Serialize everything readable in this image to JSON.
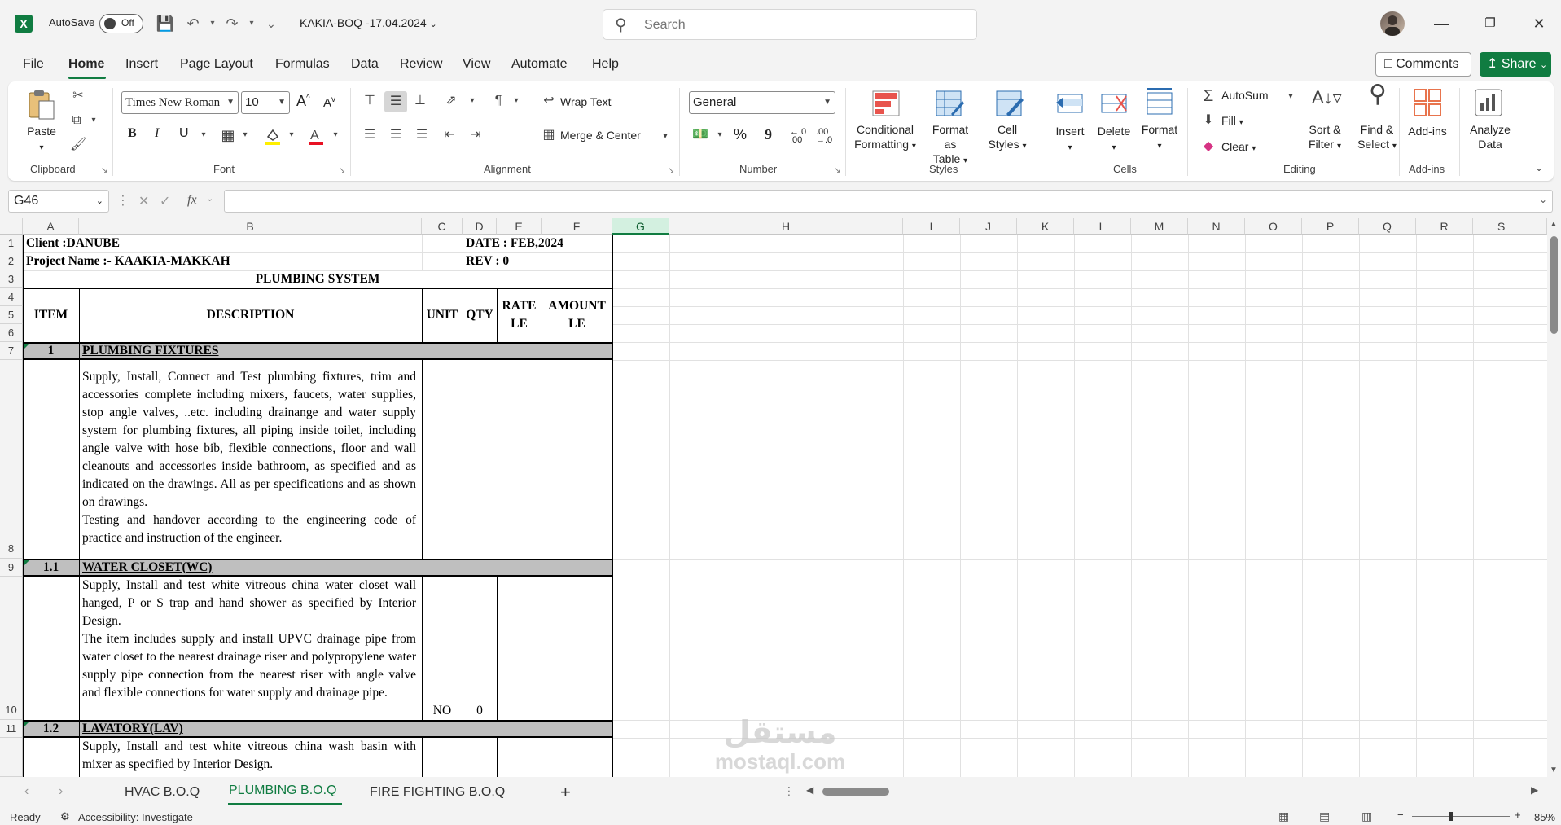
{
  "titlebar": {
    "app_logo": "X",
    "autosave_label": "AutoSave",
    "autosave_state": "Off",
    "document_title": "KAKIA-BOQ -17.04.2024",
    "search_placeholder": "Search",
    "minimize": "—",
    "restore": "❐",
    "close": "✕"
  },
  "menu": {
    "tabs": [
      "File",
      "Home",
      "Insert",
      "Page Layout",
      "Formulas",
      "Data",
      "Review",
      "View",
      "Automate",
      "Help"
    ],
    "comments_label": "Comments",
    "share_label": "Share"
  },
  "ribbon": {
    "clipboard": {
      "paste": "Paste",
      "group": "Clipboard"
    },
    "font": {
      "name": "Times New Roman",
      "size": "10",
      "bold": "B",
      "italic": "I",
      "underline": "U",
      "group": "Font"
    },
    "alignment": {
      "wrap_text": "Wrap Text",
      "merge_center": "Merge & Center",
      "group": "Alignment"
    },
    "number": {
      "format": "General",
      "percent": "%",
      "comma": "9",
      "inc_decimal": "←.0 .00",
      "dec_decimal": ".00 →.0",
      "group": "Number"
    },
    "styles": {
      "conditional_1": "Conditional",
      "conditional_2": "Formatting",
      "format_table_1": "Format as",
      "format_table_2": "Table",
      "cell_styles_1": "Cell",
      "cell_styles_2": "Styles",
      "group": "Styles"
    },
    "cells": {
      "insert": "Insert",
      "delete": "Delete",
      "format": "Format",
      "group": "Cells"
    },
    "editing": {
      "autosum": "AutoSum",
      "fill": "Fill",
      "clear": "Clear",
      "sort_1": "Sort &",
      "sort_2": "Filter",
      "find_1": "Find &",
      "find_2": "Select",
      "group": "Editing"
    },
    "addins": {
      "addins": "Add-ins",
      "group": "Add-ins",
      "analyze_1": "Analyze",
      "analyze_2": "Data"
    }
  },
  "formula_bar": {
    "name_box": "G46",
    "fx": "fx",
    "formula_value": ""
  },
  "grid": {
    "columns": [
      "A",
      "B",
      "C",
      "D",
      "E",
      "F",
      "G",
      "H",
      "I",
      "J",
      "K",
      "L",
      "M",
      "N",
      "O",
      "P",
      "Q",
      "R",
      "S"
    ],
    "selected_column": "G",
    "rows": [
      "1",
      "2",
      "3",
      "4",
      "5",
      "6",
      "7",
      "8",
      "9",
      "10",
      "11"
    ],
    "cells": {
      "client": "Client :DANUBE",
      "project": "Project Name :- KAAKIA-MAKKAH",
      "date": "DATE : FEB,2024",
      "rev": "REV : 0",
      "system": "PLUMBING SYSTEM",
      "hdr_item": "ITEM",
      "hdr_desc": "DESCRIPTION",
      "hdr_unit": "UNIT",
      "hdr_qty": "QTY",
      "hdr_rate_1": "RATE",
      "hdr_rate_2": "LE",
      "hdr_amount_1": "AMOUNT",
      "hdr_amount_2": "LE",
      "item_1": "1",
      "section_1": "PLUMBING FIXTURES",
      "desc_8": "Supply, Install, Connect and Test plumbing fixtures, trim and accessories complete including mixers, faucets, water supplies, stop angle valves, ..etc. including drainange and water supply system for plumbing fixtures, all piping inside toilet, including angle valve with hose bib, flexible connections, floor and wall cleanouts and accessories inside bathroom, as specified and as indicated on the drawings. All as per specifications and as shown on drawings.",
      "desc_8b": "Testing and handover according to the engineering code of practice and instruction of the engineer.",
      "item_11": "1.1",
      "section_11": "WATER CLOSET(WC)",
      "desc_10": "Supply, Install and test white vitreous china water closet wall hanged, P or S trap and hand shower as specified by Interior Design.",
      "desc_10b": "The item includes supply and install UPVC drainage pipe from water closet to the nearest drainage riser and polypropylene water supply pipe connection from the nearest riser with angle valve and flexible connections for water supply and drainage pipe.",
      "unit_10": "NO",
      "qty_10": "0",
      "item_12": "1.2",
      "section_12": "LAVATORY(LAV)",
      "desc_12": "Supply, Install and test white vitreous china wash basin with mixer as specified by Interior Design."
    }
  },
  "sheets": {
    "tabs": [
      "HVAC B.O.Q",
      "PLUMBING B.O.Q",
      "FIRE FIGHTING B.O.Q"
    ],
    "active": "PLUMBING B.O.Q",
    "add": "+"
  },
  "status": {
    "ready": "Ready",
    "accessibility": "Accessibility: Investigate",
    "zoom": "85%"
  },
  "watermark": {
    "line1": "مستقل",
    "line2": "mostaql.com"
  }
}
